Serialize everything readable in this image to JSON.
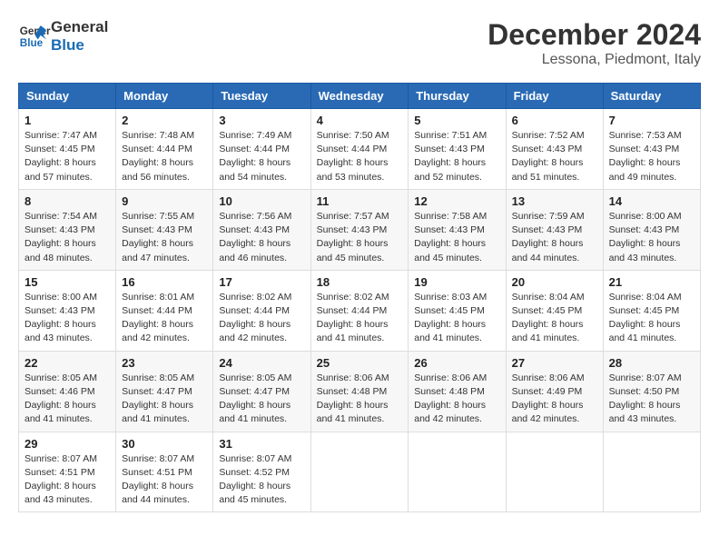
{
  "header": {
    "logo_line1": "General",
    "logo_line2": "Blue",
    "month": "December 2024",
    "location": "Lessona, Piedmont, Italy"
  },
  "days_of_week": [
    "Sunday",
    "Monday",
    "Tuesday",
    "Wednesday",
    "Thursday",
    "Friday",
    "Saturday"
  ],
  "weeks": [
    [
      {
        "day": "1",
        "sunrise": "Sunrise: 7:47 AM",
        "sunset": "Sunset: 4:45 PM",
        "daylight": "Daylight: 8 hours and 57 minutes."
      },
      {
        "day": "2",
        "sunrise": "Sunrise: 7:48 AM",
        "sunset": "Sunset: 4:44 PM",
        "daylight": "Daylight: 8 hours and 56 minutes."
      },
      {
        "day": "3",
        "sunrise": "Sunrise: 7:49 AM",
        "sunset": "Sunset: 4:44 PM",
        "daylight": "Daylight: 8 hours and 54 minutes."
      },
      {
        "day": "4",
        "sunrise": "Sunrise: 7:50 AM",
        "sunset": "Sunset: 4:44 PM",
        "daylight": "Daylight: 8 hours and 53 minutes."
      },
      {
        "day": "5",
        "sunrise": "Sunrise: 7:51 AM",
        "sunset": "Sunset: 4:43 PM",
        "daylight": "Daylight: 8 hours and 52 minutes."
      },
      {
        "day": "6",
        "sunrise": "Sunrise: 7:52 AM",
        "sunset": "Sunset: 4:43 PM",
        "daylight": "Daylight: 8 hours and 51 minutes."
      },
      {
        "day": "7",
        "sunrise": "Sunrise: 7:53 AM",
        "sunset": "Sunset: 4:43 PM",
        "daylight": "Daylight: 8 hours and 49 minutes."
      }
    ],
    [
      {
        "day": "8",
        "sunrise": "Sunrise: 7:54 AM",
        "sunset": "Sunset: 4:43 PM",
        "daylight": "Daylight: 8 hours and 48 minutes."
      },
      {
        "day": "9",
        "sunrise": "Sunrise: 7:55 AM",
        "sunset": "Sunset: 4:43 PM",
        "daylight": "Daylight: 8 hours and 47 minutes."
      },
      {
        "day": "10",
        "sunrise": "Sunrise: 7:56 AM",
        "sunset": "Sunset: 4:43 PM",
        "daylight": "Daylight: 8 hours and 46 minutes."
      },
      {
        "day": "11",
        "sunrise": "Sunrise: 7:57 AM",
        "sunset": "Sunset: 4:43 PM",
        "daylight": "Daylight: 8 hours and 45 minutes."
      },
      {
        "day": "12",
        "sunrise": "Sunrise: 7:58 AM",
        "sunset": "Sunset: 4:43 PM",
        "daylight": "Daylight: 8 hours and 45 minutes."
      },
      {
        "day": "13",
        "sunrise": "Sunrise: 7:59 AM",
        "sunset": "Sunset: 4:43 PM",
        "daylight": "Daylight: 8 hours and 44 minutes."
      },
      {
        "day": "14",
        "sunrise": "Sunrise: 8:00 AM",
        "sunset": "Sunset: 4:43 PM",
        "daylight": "Daylight: 8 hours and 43 minutes."
      }
    ],
    [
      {
        "day": "15",
        "sunrise": "Sunrise: 8:00 AM",
        "sunset": "Sunset: 4:43 PM",
        "daylight": "Daylight: 8 hours and 43 minutes."
      },
      {
        "day": "16",
        "sunrise": "Sunrise: 8:01 AM",
        "sunset": "Sunset: 4:44 PM",
        "daylight": "Daylight: 8 hours and 42 minutes."
      },
      {
        "day": "17",
        "sunrise": "Sunrise: 8:02 AM",
        "sunset": "Sunset: 4:44 PM",
        "daylight": "Daylight: 8 hours and 42 minutes."
      },
      {
        "day": "18",
        "sunrise": "Sunrise: 8:02 AM",
        "sunset": "Sunset: 4:44 PM",
        "daylight": "Daylight: 8 hours and 41 minutes."
      },
      {
        "day": "19",
        "sunrise": "Sunrise: 8:03 AM",
        "sunset": "Sunset: 4:45 PM",
        "daylight": "Daylight: 8 hours and 41 minutes."
      },
      {
        "day": "20",
        "sunrise": "Sunrise: 8:04 AM",
        "sunset": "Sunset: 4:45 PM",
        "daylight": "Daylight: 8 hours and 41 minutes."
      },
      {
        "day": "21",
        "sunrise": "Sunrise: 8:04 AM",
        "sunset": "Sunset: 4:45 PM",
        "daylight": "Daylight: 8 hours and 41 minutes."
      }
    ],
    [
      {
        "day": "22",
        "sunrise": "Sunrise: 8:05 AM",
        "sunset": "Sunset: 4:46 PM",
        "daylight": "Daylight: 8 hours and 41 minutes."
      },
      {
        "day": "23",
        "sunrise": "Sunrise: 8:05 AM",
        "sunset": "Sunset: 4:47 PM",
        "daylight": "Daylight: 8 hours and 41 minutes."
      },
      {
        "day": "24",
        "sunrise": "Sunrise: 8:05 AM",
        "sunset": "Sunset: 4:47 PM",
        "daylight": "Daylight: 8 hours and 41 minutes."
      },
      {
        "day": "25",
        "sunrise": "Sunrise: 8:06 AM",
        "sunset": "Sunset: 4:48 PM",
        "daylight": "Daylight: 8 hours and 41 minutes."
      },
      {
        "day": "26",
        "sunrise": "Sunrise: 8:06 AM",
        "sunset": "Sunset: 4:48 PM",
        "daylight": "Daylight: 8 hours and 42 minutes."
      },
      {
        "day": "27",
        "sunrise": "Sunrise: 8:06 AM",
        "sunset": "Sunset: 4:49 PM",
        "daylight": "Daylight: 8 hours and 42 minutes."
      },
      {
        "day": "28",
        "sunrise": "Sunrise: 8:07 AM",
        "sunset": "Sunset: 4:50 PM",
        "daylight": "Daylight: 8 hours and 43 minutes."
      }
    ],
    [
      {
        "day": "29",
        "sunrise": "Sunrise: 8:07 AM",
        "sunset": "Sunset: 4:51 PM",
        "daylight": "Daylight: 8 hours and 43 minutes."
      },
      {
        "day": "30",
        "sunrise": "Sunrise: 8:07 AM",
        "sunset": "Sunset: 4:51 PM",
        "daylight": "Daylight: 8 hours and 44 minutes."
      },
      {
        "day": "31",
        "sunrise": "Sunrise: 8:07 AM",
        "sunset": "Sunset: 4:52 PM",
        "daylight": "Daylight: 8 hours and 45 minutes."
      },
      null,
      null,
      null,
      null
    ]
  ]
}
